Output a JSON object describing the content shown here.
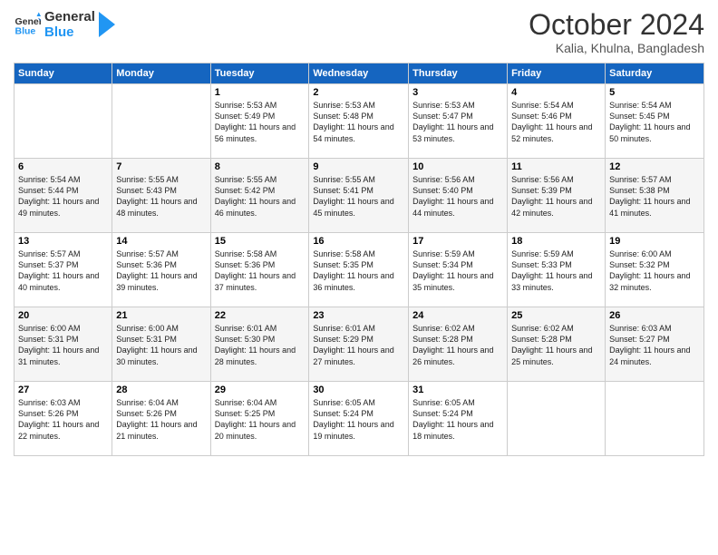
{
  "header": {
    "logo_line1": "General",
    "logo_line2": "Blue",
    "month": "October 2024",
    "location": "Kalia, Khulna, Bangladesh"
  },
  "days_of_week": [
    "Sunday",
    "Monday",
    "Tuesday",
    "Wednesday",
    "Thursday",
    "Friday",
    "Saturday"
  ],
  "weeks": [
    [
      {
        "day": "",
        "text": ""
      },
      {
        "day": "",
        "text": ""
      },
      {
        "day": "1",
        "text": "Sunrise: 5:53 AM\nSunset: 5:49 PM\nDaylight: 11 hours and 56 minutes."
      },
      {
        "day": "2",
        "text": "Sunrise: 5:53 AM\nSunset: 5:48 PM\nDaylight: 11 hours and 54 minutes."
      },
      {
        "day": "3",
        "text": "Sunrise: 5:53 AM\nSunset: 5:47 PM\nDaylight: 11 hours and 53 minutes."
      },
      {
        "day": "4",
        "text": "Sunrise: 5:54 AM\nSunset: 5:46 PM\nDaylight: 11 hours and 52 minutes."
      },
      {
        "day": "5",
        "text": "Sunrise: 5:54 AM\nSunset: 5:45 PM\nDaylight: 11 hours and 50 minutes."
      }
    ],
    [
      {
        "day": "6",
        "text": "Sunrise: 5:54 AM\nSunset: 5:44 PM\nDaylight: 11 hours and 49 minutes."
      },
      {
        "day": "7",
        "text": "Sunrise: 5:55 AM\nSunset: 5:43 PM\nDaylight: 11 hours and 48 minutes."
      },
      {
        "day": "8",
        "text": "Sunrise: 5:55 AM\nSunset: 5:42 PM\nDaylight: 11 hours and 46 minutes."
      },
      {
        "day": "9",
        "text": "Sunrise: 5:55 AM\nSunset: 5:41 PM\nDaylight: 11 hours and 45 minutes."
      },
      {
        "day": "10",
        "text": "Sunrise: 5:56 AM\nSunset: 5:40 PM\nDaylight: 11 hours and 44 minutes."
      },
      {
        "day": "11",
        "text": "Sunrise: 5:56 AM\nSunset: 5:39 PM\nDaylight: 11 hours and 42 minutes."
      },
      {
        "day": "12",
        "text": "Sunrise: 5:57 AM\nSunset: 5:38 PM\nDaylight: 11 hours and 41 minutes."
      }
    ],
    [
      {
        "day": "13",
        "text": "Sunrise: 5:57 AM\nSunset: 5:37 PM\nDaylight: 11 hours and 40 minutes."
      },
      {
        "day": "14",
        "text": "Sunrise: 5:57 AM\nSunset: 5:36 PM\nDaylight: 11 hours and 39 minutes."
      },
      {
        "day": "15",
        "text": "Sunrise: 5:58 AM\nSunset: 5:36 PM\nDaylight: 11 hours and 37 minutes."
      },
      {
        "day": "16",
        "text": "Sunrise: 5:58 AM\nSunset: 5:35 PM\nDaylight: 11 hours and 36 minutes."
      },
      {
        "day": "17",
        "text": "Sunrise: 5:59 AM\nSunset: 5:34 PM\nDaylight: 11 hours and 35 minutes."
      },
      {
        "day": "18",
        "text": "Sunrise: 5:59 AM\nSunset: 5:33 PM\nDaylight: 11 hours and 33 minutes."
      },
      {
        "day": "19",
        "text": "Sunrise: 6:00 AM\nSunset: 5:32 PM\nDaylight: 11 hours and 32 minutes."
      }
    ],
    [
      {
        "day": "20",
        "text": "Sunrise: 6:00 AM\nSunset: 5:31 PM\nDaylight: 11 hours and 31 minutes."
      },
      {
        "day": "21",
        "text": "Sunrise: 6:00 AM\nSunset: 5:31 PM\nDaylight: 11 hours and 30 minutes."
      },
      {
        "day": "22",
        "text": "Sunrise: 6:01 AM\nSunset: 5:30 PM\nDaylight: 11 hours and 28 minutes."
      },
      {
        "day": "23",
        "text": "Sunrise: 6:01 AM\nSunset: 5:29 PM\nDaylight: 11 hours and 27 minutes."
      },
      {
        "day": "24",
        "text": "Sunrise: 6:02 AM\nSunset: 5:28 PM\nDaylight: 11 hours and 26 minutes."
      },
      {
        "day": "25",
        "text": "Sunrise: 6:02 AM\nSunset: 5:28 PM\nDaylight: 11 hours and 25 minutes."
      },
      {
        "day": "26",
        "text": "Sunrise: 6:03 AM\nSunset: 5:27 PM\nDaylight: 11 hours and 24 minutes."
      }
    ],
    [
      {
        "day": "27",
        "text": "Sunrise: 6:03 AM\nSunset: 5:26 PM\nDaylight: 11 hours and 22 minutes."
      },
      {
        "day": "28",
        "text": "Sunrise: 6:04 AM\nSunset: 5:26 PM\nDaylight: 11 hours and 21 minutes."
      },
      {
        "day": "29",
        "text": "Sunrise: 6:04 AM\nSunset: 5:25 PM\nDaylight: 11 hours and 20 minutes."
      },
      {
        "day": "30",
        "text": "Sunrise: 6:05 AM\nSunset: 5:24 PM\nDaylight: 11 hours and 19 minutes."
      },
      {
        "day": "31",
        "text": "Sunrise: 6:05 AM\nSunset: 5:24 PM\nDaylight: 11 hours and 18 minutes."
      },
      {
        "day": "",
        "text": ""
      },
      {
        "day": "",
        "text": ""
      }
    ]
  ]
}
